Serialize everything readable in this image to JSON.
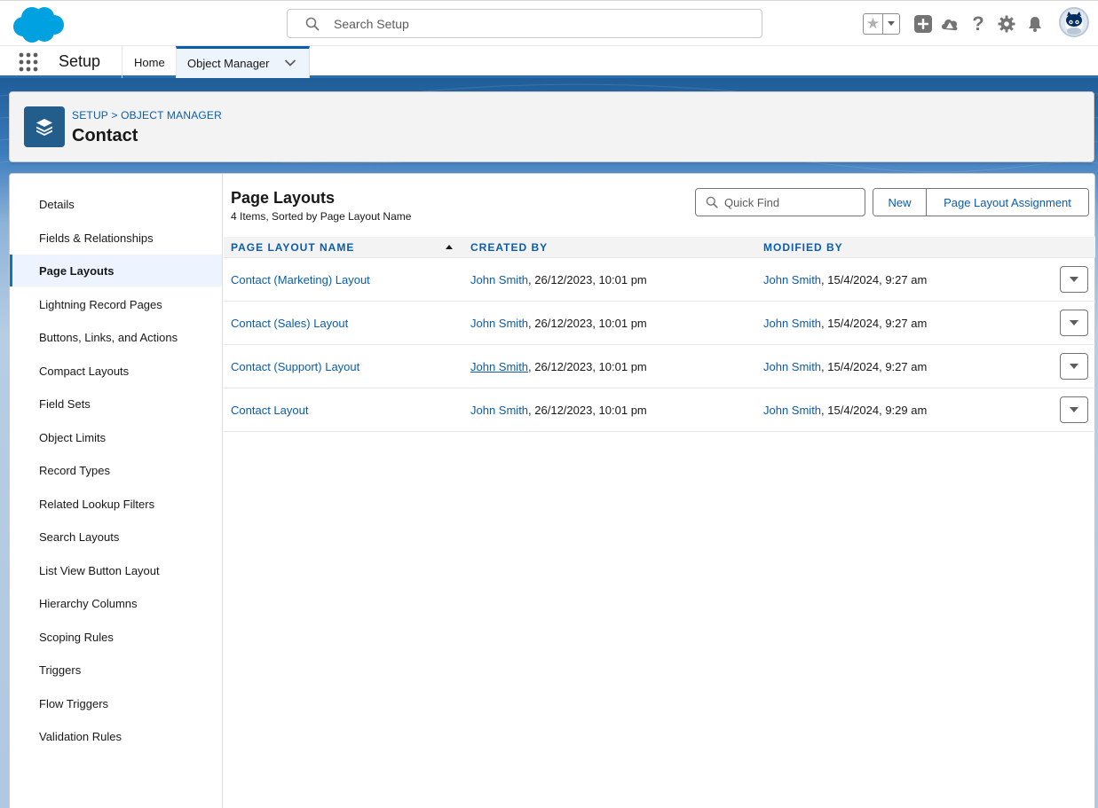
{
  "header": {
    "search_placeholder": "Search Setup"
  },
  "app_nav": {
    "app_name": "Setup",
    "tabs": [
      {
        "label": "Home"
      },
      {
        "label": "Object Manager"
      }
    ]
  },
  "object_header": {
    "breadcrumb": "SETUP > OBJECT MANAGER",
    "title": "Contact"
  },
  "sidebar": {
    "items": [
      {
        "label": "Details"
      },
      {
        "label": "Fields & Relationships"
      },
      {
        "label": "Page Layouts"
      },
      {
        "label": "Lightning Record Pages"
      },
      {
        "label": "Buttons, Links, and Actions"
      },
      {
        "label": "Compact Layouts"
      },
      {
        "label": "Field Sets"
      },
      {
        "label": "Object Limits"
      },
      {
        "label": "Record Types"
      },
      {
        "label": "Related Lookup Filters"
      },
      {
        "label": "Search Layouts"
      },
      {
        "label": "List View Button Layout"
      },
      {
        "label": "Hierarchy Columns"
      },
      {
        "label": "Scoping Rules"
      },
      {
        "label": "Triggers"
      },
      {
        "label": "Flow Triggers"
      },
      {
        "label": "Validation Rules"
      }
    ],
    "active_item": "Page Layouts"
  },
  "content": {
    "title": "Page Layouts",
    "subtitle": "4 Items, Sorted by Page Layout Name",
    "quick_find_placeholder": "Quick Find",
    "new_button": "New",
    "assignment_button": "Page Layout Assignment",
    "columns": {
      "name": "PAGE LAYOUT NAME",
      "created": "CREATED BY",
      "modified": "MODIFIED BY"
    },
    "rows": [
      {
        "name": "Contact (Marketing) Layout",
        "created_user": "John Smith",
        "created_date": ", 26/12/2023, 10:01 pm",
        "modified_user": "John Smith",
        "modified_date": ", 15/4/2024, 9:27 am"
      },
      {
        "name": "Contact (Sales) Layout",
        "created_user": "John Smith",
        "created_date": ", 26/12/2023, 10:01 pm",
        "modified_user": "John Smith",
        "modified_date": ", 15/4/2024, 9:27 am"
      },
      {
        "name": "Contact (Support) Layout",
        "created_user": "John Smith",
        "created_date": ", 26/12/2023, 10:01 pm",
        "modified_user": "John Smith",
        "modified_date": ", 15/4/2024, 9:27 am"
      },
      {
        "name": "Contact Layout",
        "created_user": "John Smith",
        "created_date": ", 26/12/2023, 10:01 pm",
        "modified_user": "John Smith",
        "modified_date": ", 15/4/2024, 9:29 am"
      }
    ]
  },
  "colors": {
    "brand_blue": "#0b5cab",
    "salesforce_cloud": "#00a1e0",
    "object_icon": "#235d8c"
  },
  "icons": [
    "salesforce-logo",
    "search-icon",
    "star-icon",
    "chevron-down-icon",
    "plus-icon",
    "trailhead-icon",
    "help-icon",
    "gear-icon",
    "bell-icon",
    "avatar",
    "waffle-icon",
    "layers-icon"
  ]
}
